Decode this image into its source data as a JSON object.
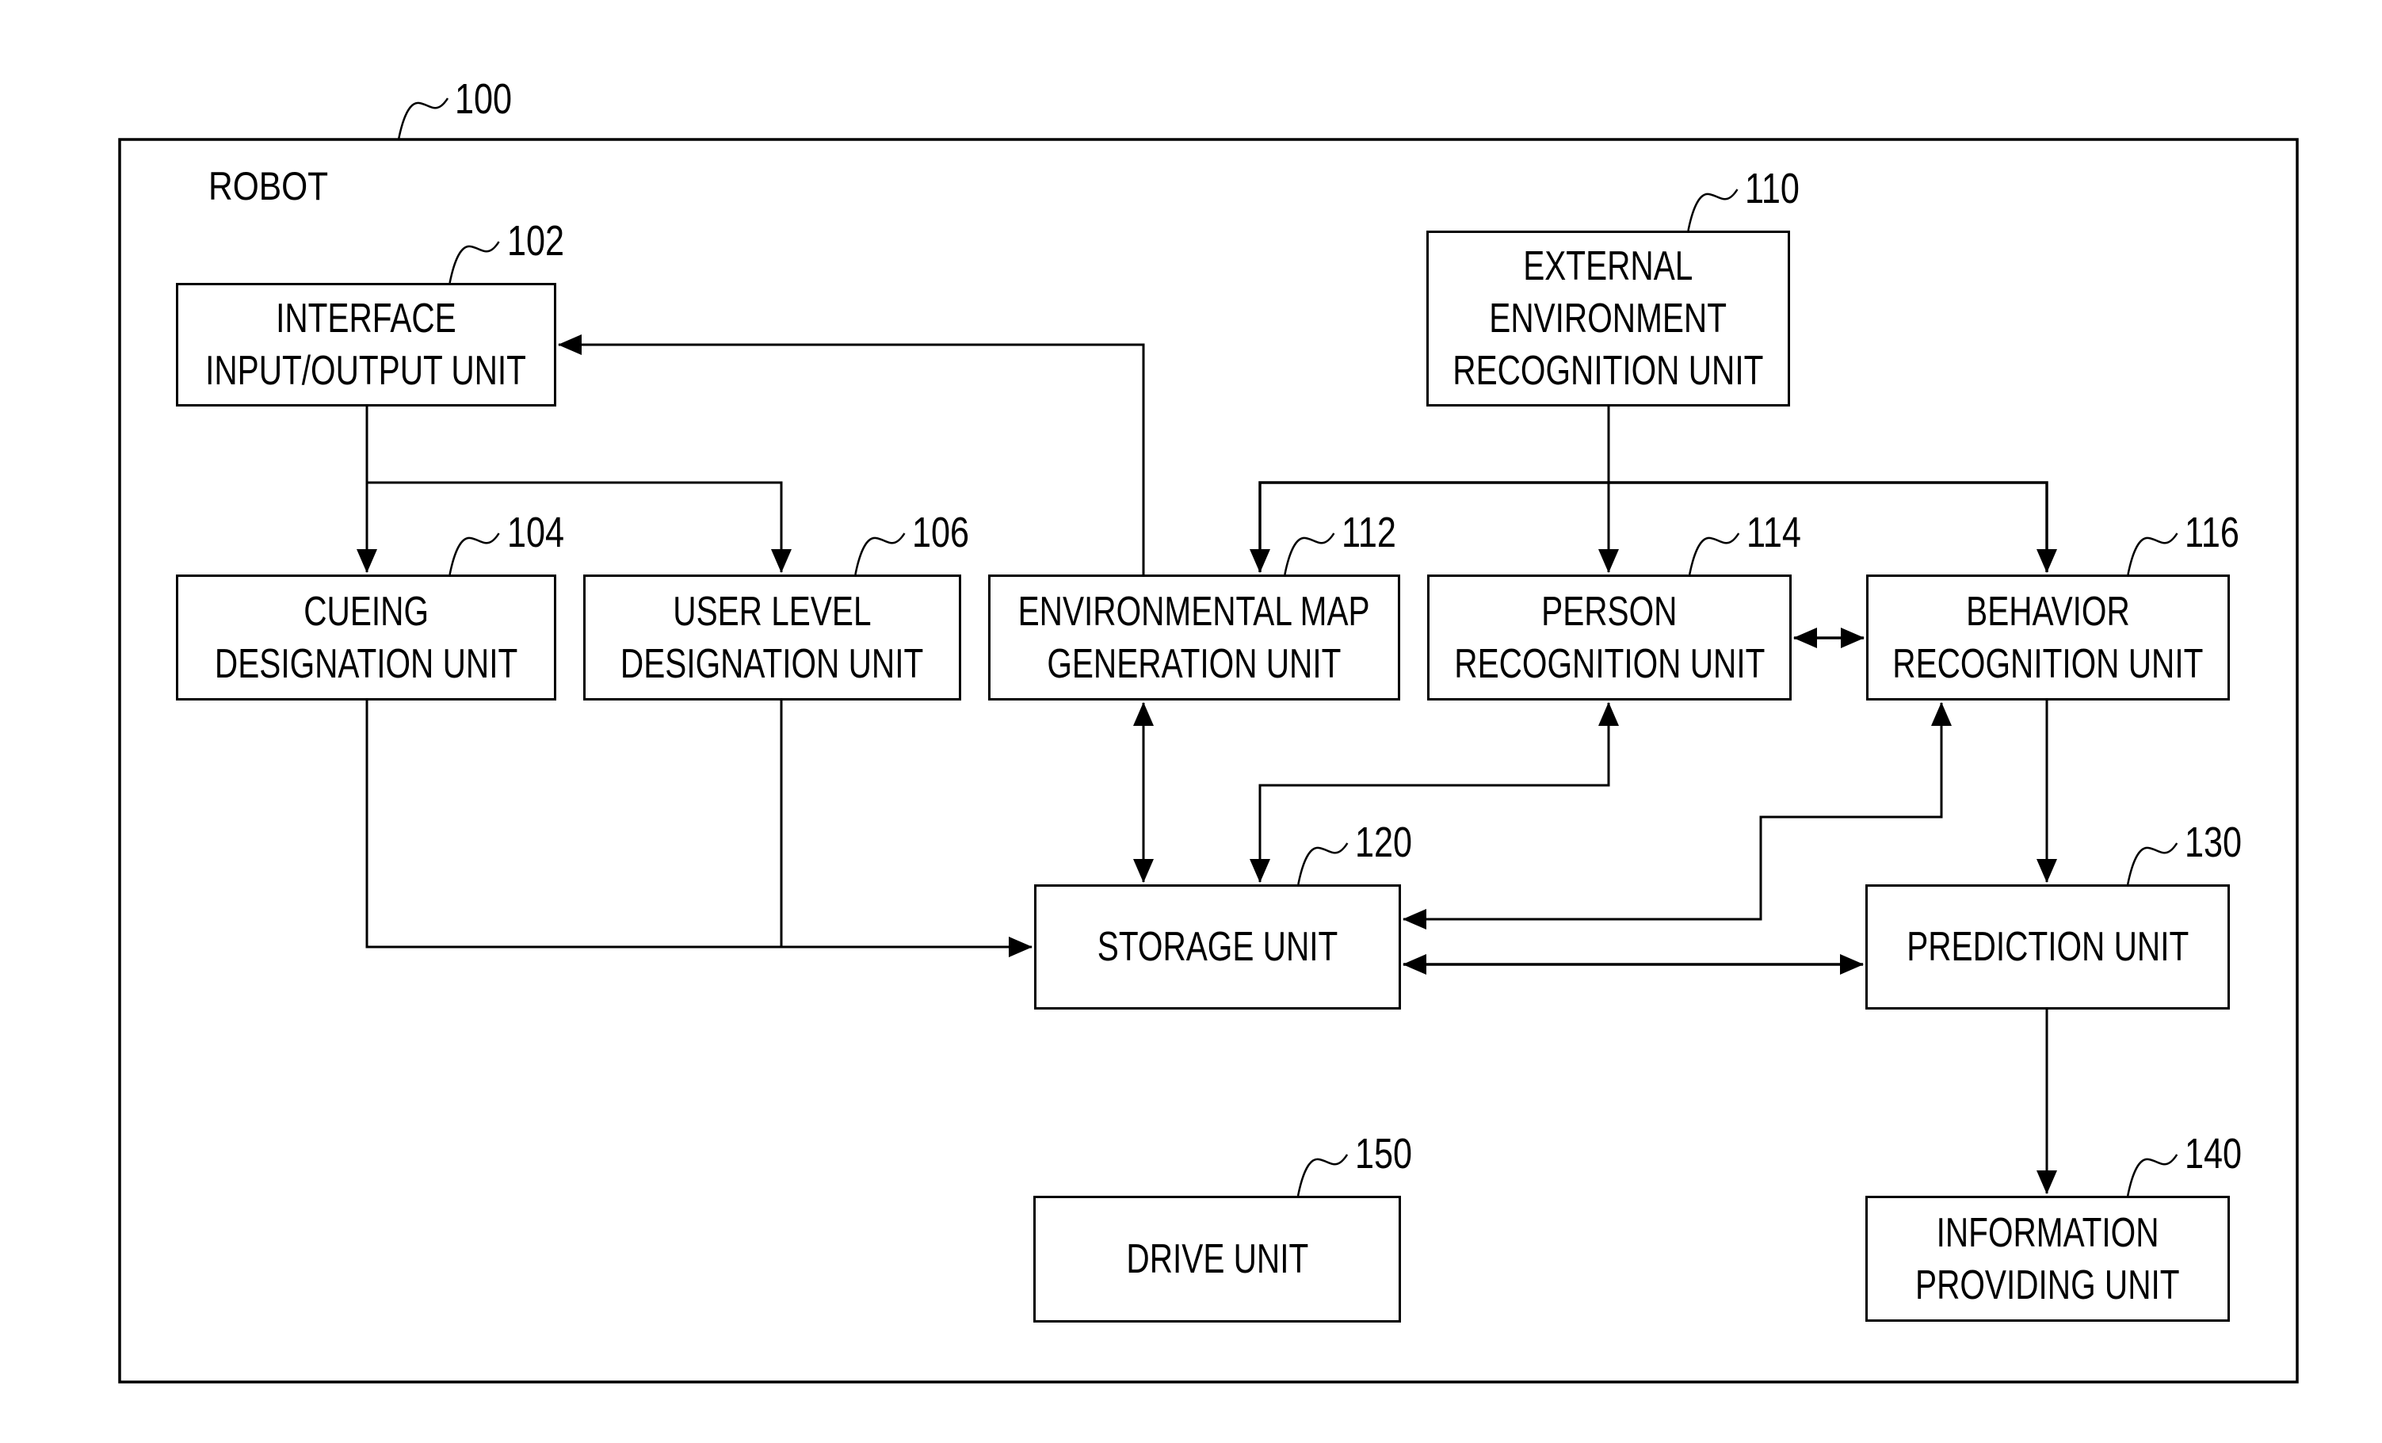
{
  "figure": {
    "system_label": "ROBOT",
    "system_ref": "100"
  },
  "units": [
    {
      "id": "interface_io",
      "ref": "102",
      "lines": [
        "INTERFACE",
        "INPUT/OUTPUT UNIT"
      ]
    },
    {
      "id": "cueing",
      "ref": "104",
      "lines": [
        "CUEING",
        "DESIGNATION UNIT"
      ]
    },
    {
      "id": "user_level",
      "ref": "106",
      "lines": [
        "USER LEVEL",
        "DESIGNATION UNIT"
      ]
    },
    {
      "id": "external_env",
      "ref": "110",
      "lines": [
        "EXTERNAL",
        "ENVIRONMENT",
        "RECOGNITION UNIT"
      ]
    },
    {
      "id": "env_map",
      "ref": "112",
      "lines": [
        "ENVIRONMENTAL MAP",
        "GENERATION UNIT"
      ]
    },
    {
      "id": "person",
      "ref": "114",
      "lines": [
        "PERSON",
        "RECOGNITION UNIT"
      ]
    },
    {
      "id": "behavior",
      "ref": "116",
      "lines": [
        "BEHAVIOR",
        "RECOGNITION UNIT"
      ]
    },
    {
      "id": "storage",
      "ref": "120",
      "lines": [
        "STORAGE UNIT"
      ]
    },
    {
      "id": "prediction",
      "ref": "130",
      "lines": [
        "PREDICTION UNIT"
      ]
    },
    {
      "id": "info_providing",
      "ref": "140",
      "lines": [
        "INFORMATION",
        "PROVIDING UNIT"
      ]
    },
    {
      "id": "drive",
      "ref": "150",
      "lines": [
        "DRIVE UNIT"
      ]
    }
  ],
  "connections": [
    {
      "from": "interface_io",
      "to": "cueing",
      "direction": "one-way"
    },
    {
      "from": "interface_io",
      "to": "user_level",
      "direction": "one-way"
    },
    {
      "from": "env_map",
      "to": "interface_io",
      "direction": "one-way"
    },
    {
      "from": "external_env",
      "to": "env_map",
      "direction": "one-way"
    },
    {
      "from": "external_env",
      "to": "person",
      "direction": "one-way"
    },
    {
      "from": "external_env",
      "to": "behavior",
      "direction": "one-way"
    },
    {
      "from": "person",
      "to": "behavior",
      "direction": "two-way"
    },
    {
      "from": "env_map",
      "to": "storage",
      "direction": "two-way"
    },
    {
      "from": "storage",
      "to": "person",
      "direction": "one-way"
    },
    {
      "from": "behavior",
      "to": "storage",
      "direction": "two-way"
    },
    {
      "from": "cueing",
      "to": "storage",
      "direction": "one-way"
    },
    {
      "from": "user_level",
      "to": "storage",
      "direction": "one-way"
    },
    {
      "from": "storage",
      "to": "prediction",
      "direction": "two-way"
    },
    {
      "from": "behavior",
      "to": "prediction",
      "direction": "one-way"
    },
    {
      "from": "prediction",
      "to": "info_providing",
      "direction": "one-way"
    }
  ]
}
